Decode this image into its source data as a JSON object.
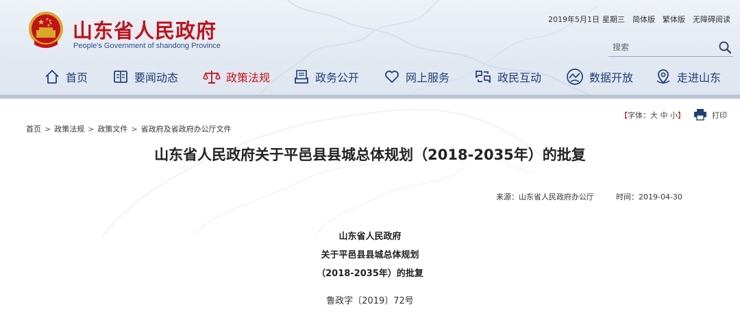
{
  "header": {
    "site_title": "山东省人民政府",
    "site_subtitle": "People's Government of shandong Province",
    "top_links": {
      "date": "2019年5月1日",
      "weekday": "星期三",
      "simplified": "简体版",
      "traditional": "繁体版",
      "accessible": "无障碍阅读"
    },
    "search": {
      "placeholder": "搜索"
    },
    "nav": [
      {
        "label": "首页",
        "icon": "home-icon"
      },
      {
        "label": "要闻动态",
        "icon": "news-book-icon"
      },
      {
        "label": "政策法规",
        "icon": "scales-icon",
        "active": true
      },
      {
        "label": "政务公开",
        "icon": "document-box-icon"
      },
      {
        "label": "网上服务",
        "icon": "heart-service-icon"
      },
      {
        "label": "政民互动",
        "icon": "interaction-icon"
      },
      {
        "label": "数据开放",
        "icon": "data-globe-icon"
      },
      {
        "label": "走进山东",
        "icon": "location-pin-icon"
      }
    ],
    "colors": {
      "brand_red": "#c1121a",
      "nav_blue": "#1e3e76"
    }
  },
  "page_tools": {
    "font_label": "字体",
    "font_sizes": [
      "大",
      "中",
      "小"
    ],
    "print_label": "打印"
  },
  "breadcrumb": [
    "首页",
    "政策法规",
    "政策文件",
    "省政府及省政府办公厅文件"
  ],
  "article": {
    "title": "山东省人民政府关于平邑县县城总体规划（2018-2035年）的批复",
    "source_label": "来源：山东省人民政府办公厅",
    "time_label": "时间：2019-04-30",
    "doc_heading": [
      "山东省人民政府",
      "关于平邑县县城总体规划",
      "（2018-2035年）的批复"
    ],
    "doc_number": "鲁政字〔2019〕72号"
  }
}
